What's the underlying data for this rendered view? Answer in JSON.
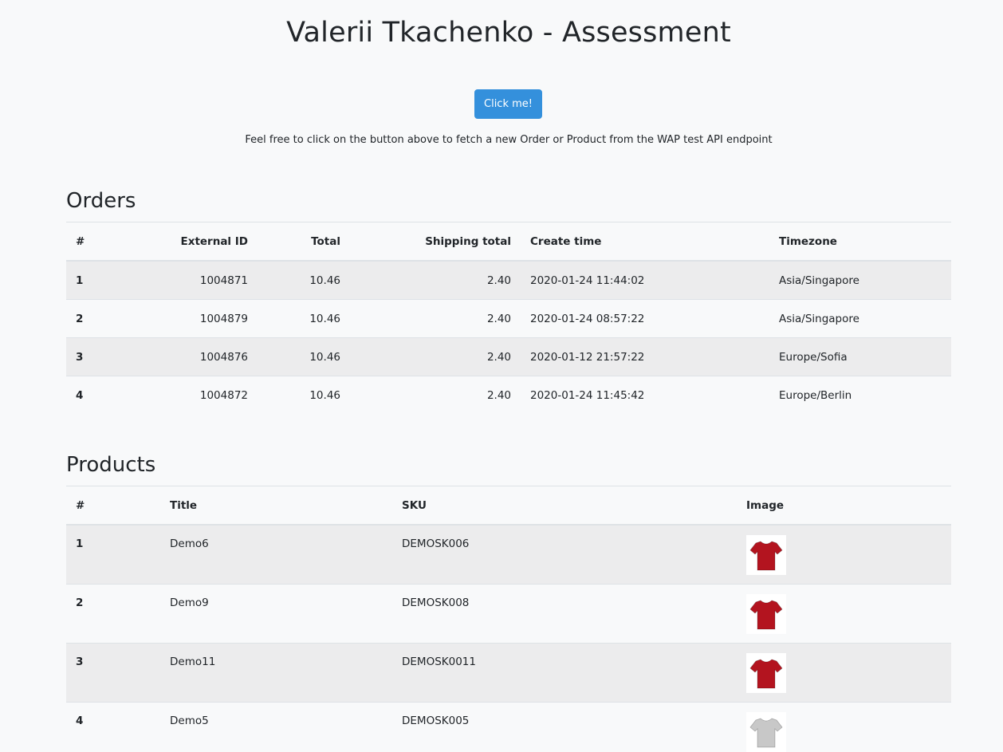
{
  "page": {
    "title": "Valerii Tkachenko - Assessment",
    "button_label": "Click me!",
    "hint": "Feel free to click on the button above to fetch a new Order or Product from the WAP test API endpoint"
  },
  "orders": {
    "heading": "Orders",
    "columns": [
      "#",
      "External ID",
      "Total",
      "Shipping total",
      "Create time",
      "Timezone"
    ],
    "rows": [
      {
        "index": "1",
        "external_id": "1004871",
        "total": "10.46",
        "shipping_total": "2.40",
        "create_time": "2020-01-24 11:44:02",
        "timezone": "Asia/Singapore"
      },
      {
        "index": "2",
        "external_id": "1004879",
        "total": "10.46",
        "shipping_total": "2.40",
        "create_time": "2020-01-24 08:57:22",
        "timezone": "Asia/Singapore"
      },
      {
        "index": "3",
        "external_id": "1004876",
        "total": "10.46",
        "shipping_total": "2.40",
        "create_time": "2020-01-12 21:57:22",
        "timezone": "Europe/Sofia"
      },
      {
        "index": "4",
        "external_id": "1004872",
        "total": "10.46",
        "shipping_total": "2.40",
        "create_time": "2020-01-24 11:45:42",
        "timezone": "Europe/Berlin"
      }
    ]
  },
  "products": {
    "heading": "Products",
    "columns": [
      "#",
      "Title",
      "SKU",
      "Image"
    ],
    "rows": [
      {
        "index": "1",
        "title": "Demo6",
        "sku": "DEMOSK006",
        "image": "tshirt-icon",
        "shirt_color": "#b3141f"
      },
      {
        "index": "2",
        "title": "Demo9",
        "sku": "DEMOSK008",
        "image": "tshirt-icon",
        "shirt_color": "#b3141f"
      },
      {
        "index": "3",
        "title": "Demo11",
        "sku": "DEMOSK0011",
        "image": "tshirt-icon",
        "shirt_color": "#b3141f"
      },
      {
        "index": "4",
        "title": "Demo5",
        "sku": "DEMOSK005",
        "image": "tshirt-icon",
        "shirt_color": "#c8c8c8"
      }
    ]
  },
  "colors": {
    "accent": "#3490dc",
    "background": "#f8f9fa",
    "stripe": "#ececed"
  }
}
